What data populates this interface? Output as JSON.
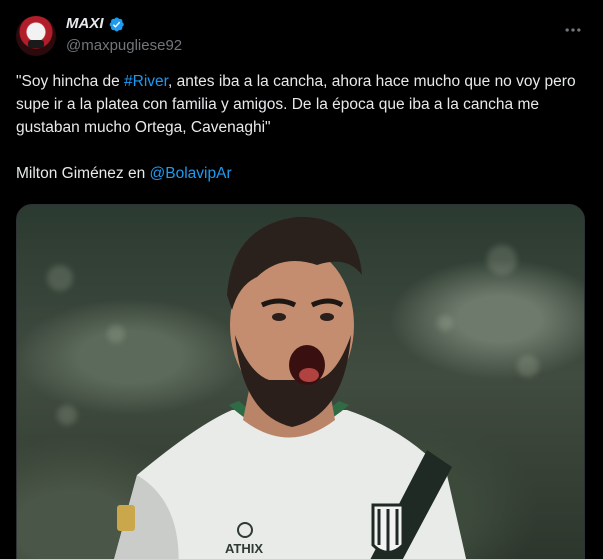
{
  "author": {
    "display_name": "MAXI",
    "handle": "@maxpugliese92",
    "verified": true,
    "avatar_icon": "avatar-image"
  },
  "tweet": {
    "text_parts": {
      "p1_a": "\"Soy hincha de ",
      "p1_hashtag": "#River",
      "p1_b": ", antes iba a la cancha, ahora hace mucho que no voy pero supe ir a la platea con familia y amigos. De la época que iba a la cancha me gustaban mucho Ortega, Cavenaghi\"",
      "p2_a": "Milton Giménez en ",
      "p2_mention": "@BolavipAr"
    }
  },
  "media": {
    "jersey_text": "ATHIX"
  },
  "colors": {
    "background": "#000000",
    "text": "#e7e9ea",
    "secondary": "#71767b",
    "link": "#1d9bf0",
    "verified": "#1d9bf0"
  },
  "icons": {
    "more": "more-dots-icon",
    "verified": "verified-badge-icon"
  }
}
